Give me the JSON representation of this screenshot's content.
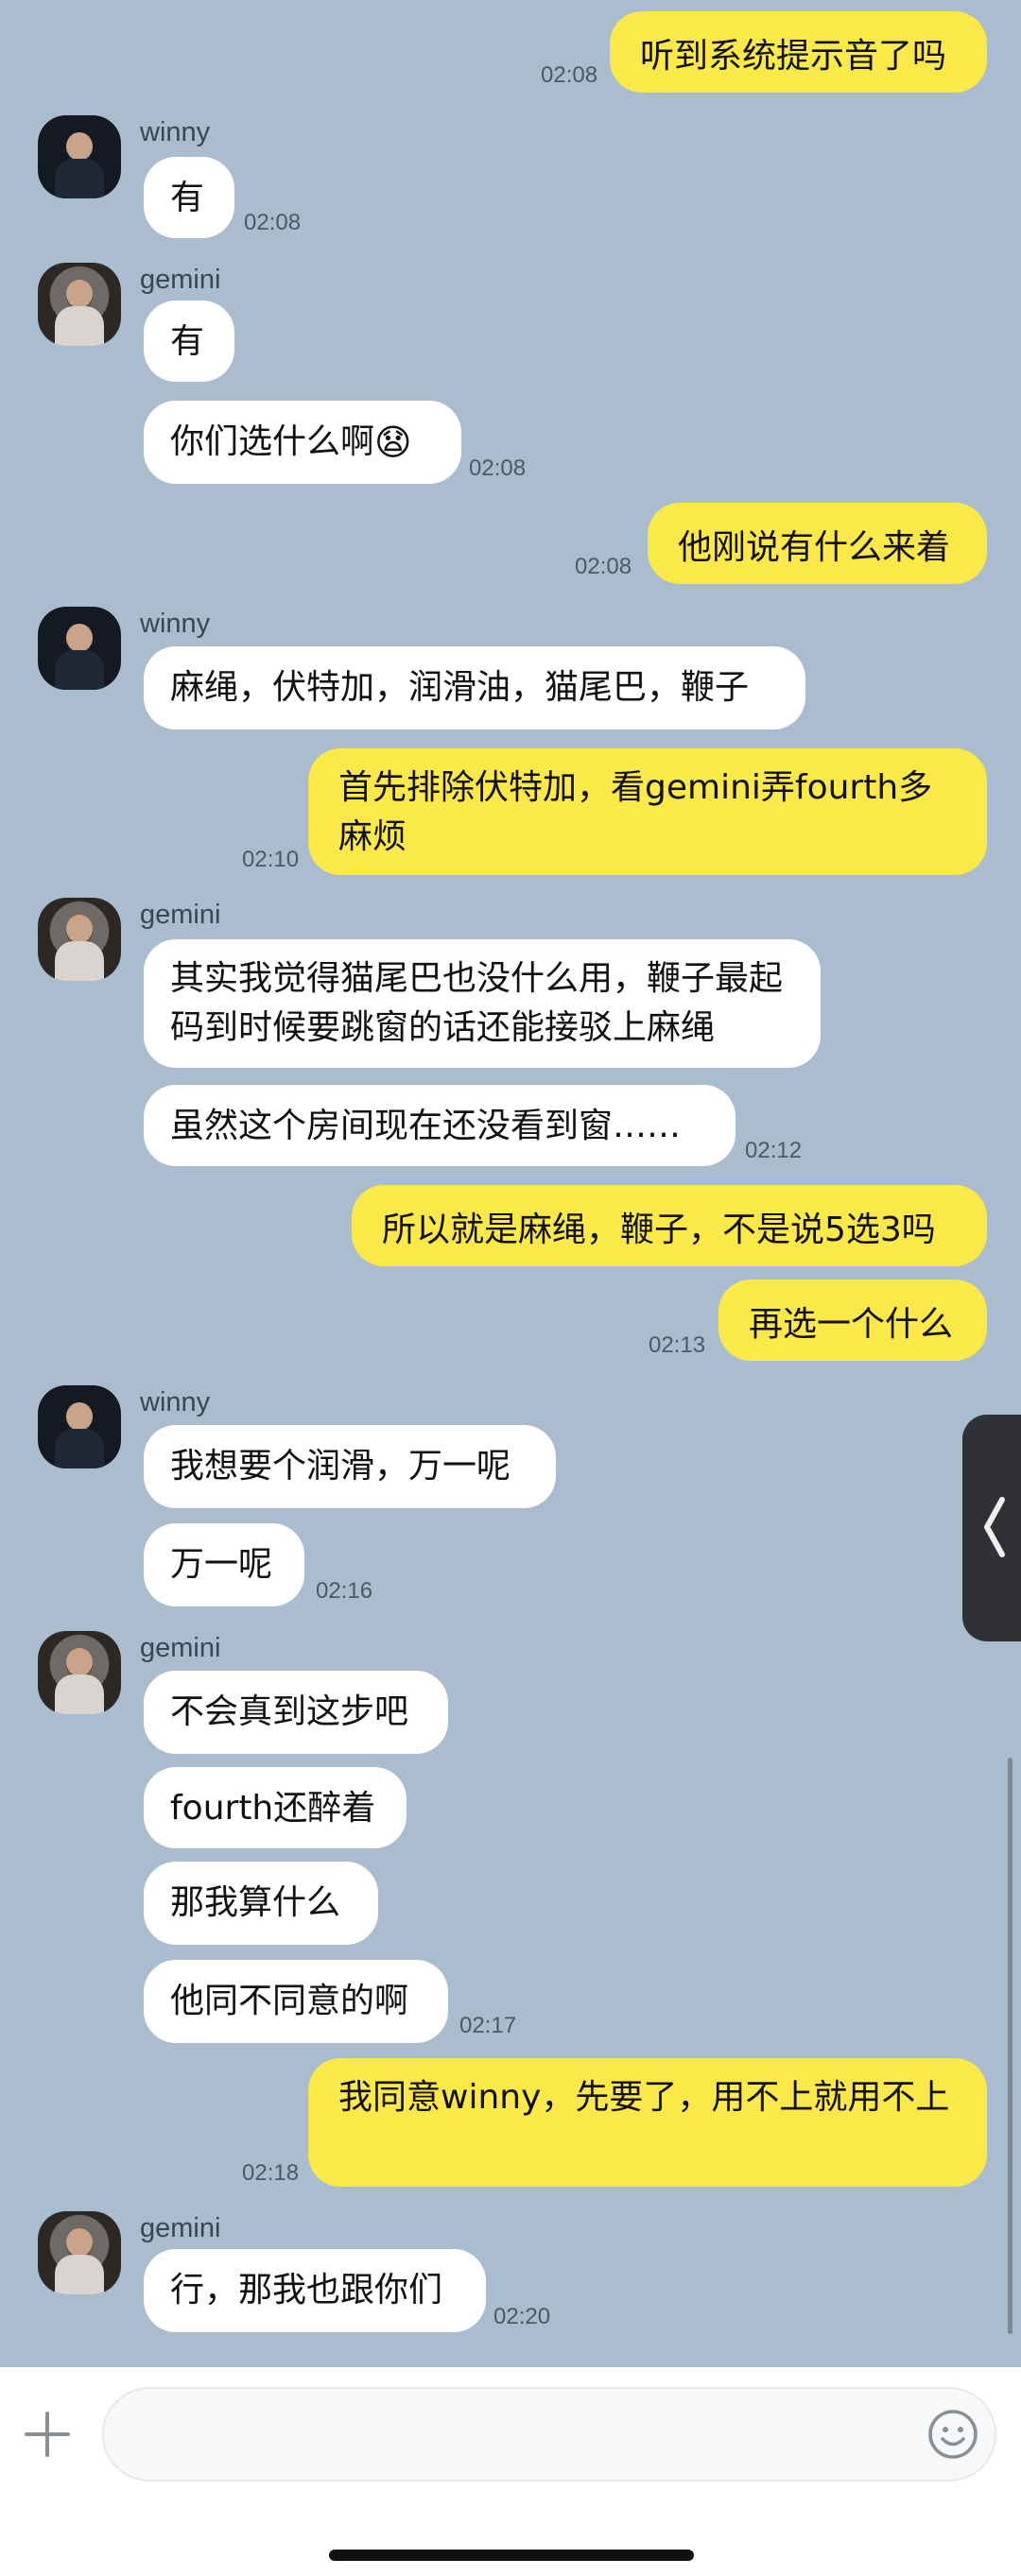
{
  "chat": {
    "messages": [
      {
        "side": "out",
        "text": "听到系统提示音了吗",
        "time": "02:08"
      },
      {
        "side": "in",
        "sender": "winny",
        "text": "有",
        "time": "02:08"
      },
      {
        "side": "in",
        "sender": "gemini",
        "text": "有",
        "time": ""
      },
      {
        "side": "in",
        "sender": "",
        "text": "你们选什么啊",
        "emoji": "😧",
        "time": "02:08"
      },
      {
        "side": "out",
        "text": "他刚说有什么来着",
        "time": "02:08"
      },
      {
        "side": "in",
        "sender": "winny",
        "text": "麻绳，伏特加，润滑油，猫尾巴，鞭子",
        "time": ""
      },
      {
        "side": "out",
        "text": "首先排除伏特加，看gemini弄fourth多麻烦",
        "time": "02:10"
      },
      {
        "side": "in",
        "sender": "gemini",
        "text": "其实我觉得猫尾巴也没什么用，鞭子最起码到时候要跳窗的话还能接驳上麻绳",
        "time": ""
      },
      {
        "side": "in",
        "sender": "",
        "text": "虽然这个房间现在还没看到窗……",
        "time": "02:12"
      },
      {
        "side": "out",
        "text": "所以就是麻绳，鞭子，不是说5选3吗",
        "time": ""
      },
      {
        "side": "out",
        "text": "再选一个什么",
        "time": "02:13"
      },
      {
        "side": "in",
        "sender": "winny",
        "text": "我想要个润滑，万一呢",
        "time": ""
      },
      {
        "side": "in",
        "sender": "",
        "text": "万一呢",
        "time": "02:16"
      },
      {
        "side": "in",
        "sender": "gemini",
        "text": "不会真到这步吧",
        "time": ""
      },
      {
        "side": "in",
        "sender": "",
        "text": "fourth还醉着",
        "time": ""
      },
      {
        "side": "in",
        "sender": "",
        "text": "那我算什么",
        "time": ""
      },
      {
        "side": "in",
        "sender": "",
        "text": "他同不同意的啊",
        "time": "02:17"
      },
      {
        "side": "out",
        "text": "我同意winny，先要了，用不上就用不上",
        "time": "02:18"
      },
      {
        "side": "in",
        "sender": "gemini",
        "text": "行，那我也跟你们",
        "time": "02:20"
      }
    ]
  },
  "input": {
    "placeholder": "",
    "value": "",
    "plus_icon": "plus-icon",
    "emoji_icon": "emoji-icon"
  },
  "colors": {
    "background": "#A9BDCE",
    "outgoing_bubble": "#FBE94A",
    "incoming_bubble": "#FFFFFF"
  }
}
